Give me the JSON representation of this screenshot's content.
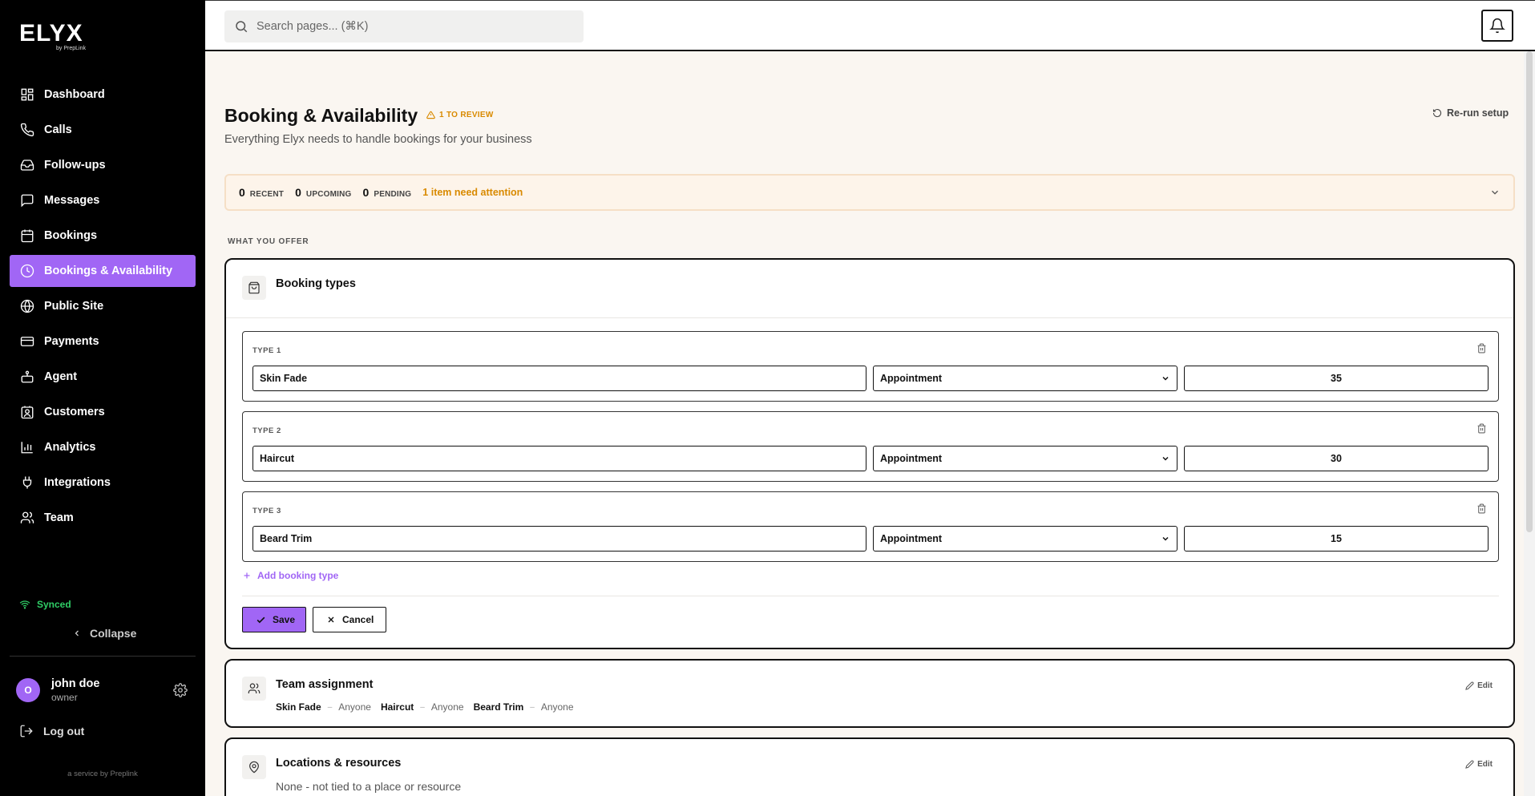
{
  "brand": {
    "logo": "ELYX",
    "tagline": "by PrepLink"
  },
  "sidebar": {
    "items": [
      {
        "label": "Dashboard",
        "icon": "dashboard-icon"
      },
      {
        "label": "Calls",
        "icon": "phone-icon"
      },
      {
        "label": "Follow-ups",
        "icon": "inbox-icon"
      },
      {
        "label": "Messages",
        "icon": "message-icon"
      },
      {
        "label": "Bookings",
        "icon": "calendar-icon"
      },
      {
        "label": "Bookings & Availability",
        "icon": "clock-icon",
        "active": true
      },
      {
        "label": "Public Site",
        "icon": "globe-icon"
      },
      {
        "label": "Payments",
        "icon": "credit-card-icon"
      },
      {
        "label": "Agent",
        "icon": "bot-icon"
      },
      {
        "label": "Customers",
        "icon": "contact-icon"
      },
      {
        "label": "Analytics",
        "icon": "chart-icon"
      },
      {
        "label": "Integrations",
        "icon": "plug-icon"
      },
      {
        "label": "Team",
        "icon": "users-icon"
      }
    ],
    "synced": "Synced",
    "collapse": "Collapse",
    "user": {
      "initial": "O",
      "name": "john doe",
      "role": "owner"
    },
    "logout": "Log out",
    "service": "a service by Preplink"
  },
  "topbar": {
    "search_placeholder": "Search pages... (⌘K)"
  },
  "page": {
    "title": "Booking & Availability",
    "review_badge": "1 TO REVIEW",
    "subtitle": "Everything Elyx needs to handle bookings for your business",
    "rerun": "Re-run setup"
  },
  "stats": {
    "recent_num": "0",
    "recent_label": "RECENT",
    "upcoming_num": "0",
    "upcoming_label": "UPCOMING",
    "pending_num": "0",
    "pending_label": "PENDING",
    "alert": "1 item need attention"
  },
  "section_label": "WHAT YOU OFFER",
  "booking_types": {
    "title": "Booking types",
    "types": [
      {
        "label": "TYPE 1",
        "name": "Skin Fade",
        "kind": "Appointment",
        "duration": "35"
      },
      {
        "label": "TYPE 2",
        "name": "Haircut",
        "kind": "Appointment",
        "duration": "30"
      },
      {
        "label": "TYPE 3",
        "name": "Beard Trim",
        "kind": "Appointment",
        "duration": "15"
      }
    ],
    "add_label": "Add booking type",
    "save_label": "Save",
    "cancel_label": "Cancel"
  },
  "team_assignment": {
    "title": "Team assignment",
    "edit": "Edit",
    "rows": [
      {
        "service": "Skin Fade",
        "who": "Anyone"
      },
      {
        "service": "Haircut",
        "who": "Anyone"
      },
      {
        "service": "Beard Trim",
        "who": "Anyone"
      }
    ]
  },
  "locations": {
    "title": "Locations & resources",
    "edit": "Edit",
    "text": "None - not tied to a place or resource"
  },
  "colors": {
    "accent": "#a166f5",
    "warning": "#d98a00",
    "synced": "#2fce66"
  }
}
